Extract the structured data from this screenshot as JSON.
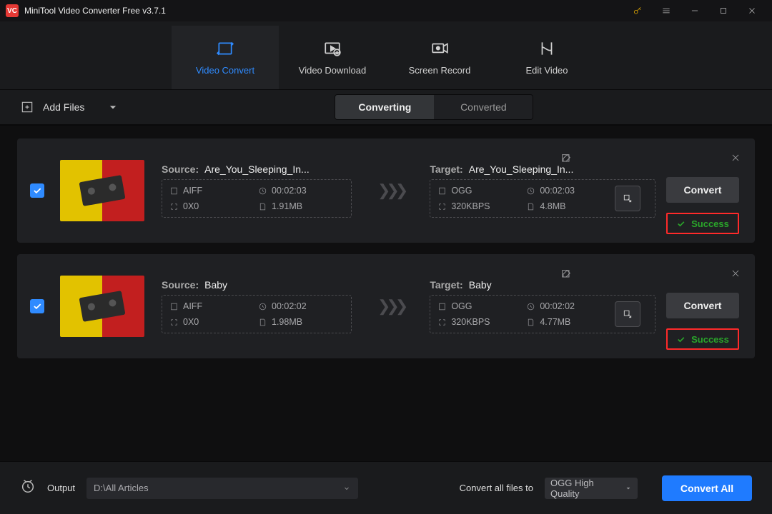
{
  "title": "MiniTool Video Converter Free v3.7.1",
  "mainTabs": {
    "convert": "Video Convert",
    "download": "Video Download",
    "record": "Screen Record",
    "edit": "Edit Video"
  },
  "toolbar": {
    "add_files": "Add Files",
    "seg_converting": "Converting",
    "seg_converted": "Converted"
  },
  "rows": [
    {
      "src_label": "Source:",
      "src_name": "Are_You_Sleeping_In...",
      "src_fmt": "AIFF",
      "src_dur": "00:02:03",
      "src_res": "0X0",
      "src_size": "1.91MB",
      "tgt_label": "Target:",
      "tgt_name": "Are_You_Sleeping_In...",
      "tgt_fmt": "OGG",
      "tgt_dur": "00:02:03",
      "tgt_bitrate": "320KBPS",
      "tgt_size": "4.8MB",
      "convert": "Convert",
      "status": "Success"
    },
    {
      "src_label": "Source:",
      "src_name": "Baby",
      "src_fmt": "AIFF",
      "src_dur": "00:02:02",
      "src_res": "0X0",
      "src_size": "1.98MB",
      "tgt_label": "Target:",
      "tgt_name": "Baby",
      "tgt_fmt": "OGG",
      "tgt_dur": "00:02:02",
      "tgt_bitrate": "320KBPS",
      "tgt_size": "4.77MB",
      "convert": "Convert",
      "status": "Success"
    }
  ],
  "footer": {
    "output_label": "Output",
    "output_path": "D:\\All Articles",
    "convert_all_label": "Convert all files to",
    "format_selected": "OGG High Quality",
    "convert_all_btn": "Convert All"
  }
}
